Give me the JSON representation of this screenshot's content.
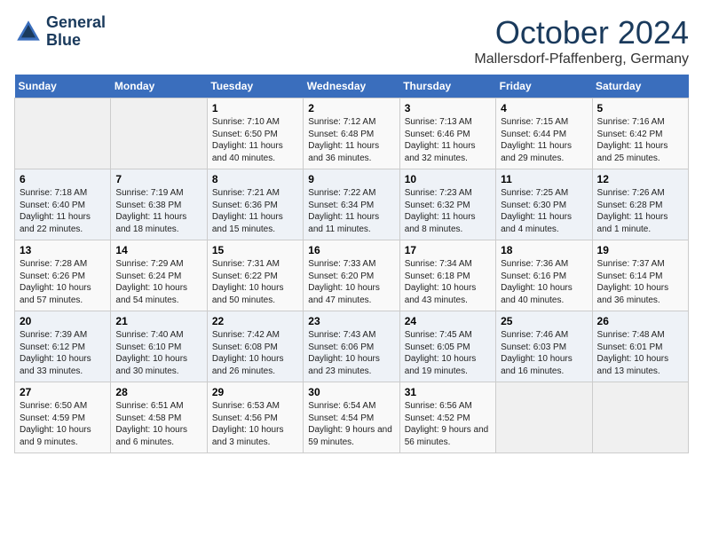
{
  "header": {
    "logo_line1": "General",
    "logo_line2": "Blue",
    "month": "October 2024",
    "location": "Mallersdorf-Pfaffenberg, Germany"
  },
  "weekdays": [
    "Sunday",
    "Monday",
    "Tuesday",
    "Wednesday",
    "Thursday",
    "Friday",
    "Saturday"
  ],
  "weeks": [
    [
      {
        "day": "",
        "info": ""
      },
      {
        "day": "",
        "info": ""
      },
      {
        "day": "1",
        "info": "Sunrise: 7:10 AM\nSunset: 6:50 PM\nDaylight: 11 hours and 40 minutes."
      },
      {
        "day": "2",
        "info": "Sunrise: 7:12 AM\nSunset: 6:48 PM\nDaylight: 11 hours and 36 minutes."
      },
      {
        "day": "3",
        "info": "Sunrise: 7:13 AM\nSunset: 6:46 PM\nDaylight: 11 hours and 32 minutes."
      },
      {
        "day": "4",
        "info": "Sunrise: 7:15 AM\nSunset: 6:44 PM\nDaylight: 11 hours and 29 minutes."
      },
      {
        "day": "5",
        "info": "Sunrise: 7:16 AM\nSunset: 6:42 PM\nDaylight: 11 hours and 25 minutes."
      }
    ],
    [
      {
        "day": "6",
        "info": "Sunrise: 7:18 AM\nSunset: 6:40 PM\nDaylight: 11 hours and 22 minutes."
      },
      {
        "day": "7",
        "info": "Sunrise: 7:19 AM\nSunset: 6:38 PM\nDaylight: 11 hours and 18 minutes."
      },
      {
        "day": "8",
        "info": "Sunrise: 7:21 AM\nSunset: 6:36 PM\nDaylight: 11 hours and 15 minutes."
      },
      {
        "day": "9",
        "info": "Sunrise: 7:22 AM\nSunset: 6:34 PM\nDaylight: 11 hours and 11 minutes."
      },
      {
        "day": "10",
        "info": "Sunrise: 7:23 AM\nSunset: 6:32 PM\nDaylight: 11 hours and 8 minutes."
      },
      {
        "day": "11",
        "info": "Sunrise: 7:25 AM\nSunset: 6:30 PM\nDaylight: 11 hours and 4 minutes."
      },
      {
        "day": "12",
        "info": "Sunrise: 7:26 AM\nSunset: 6:28 PM\nDaylight: 11 hours and 1 minute."
      }
    ],
    [
      {
        "day": "13",
        "info": "Sunrise: 7:28 AM\nSunset: 6:26 PM\nDaylight: 10 hours and 57 minutes."
      },
      {
        "day": "14",
        "info": "Sunrise: 7:29 AM\nSunset: 6:24 PM\nDaylight: 10 hours and 54 minutes."
      },
      {
        "day": "15",
        "info": "Sunrise: 7:31 AM\nSunset: 6:22 PM\nDaylight: 10 hours and 50 minutes."
      },
      {
        "day": "16",
        "info": "Sunrise: 7:33 AM\nSunset: 6:20 PM\nDaylight: 10 hours and 47 minutes."
      },
      {
        "day": "17",
        "info": "Sunrise: 7:34 AM\nSunset: 6:18 PM\nDaylight: 10 hours and 43 minutes."
      },
      {
        "day": "18",
        "info": "Sunrise: 7:36 AM\nSunset: 6:16 PM\nDaylight: 10 hours and 40 minutes."
      },
      {
        "day": "19",
        "info": "Sunrise: 7:37 AM\nSunset: 6:14 PM\nDaylight: 10 hours and 36 minutes."
      }
    ],
    [
      {
        "day": "20",
        "info": "Sunrise: 7:39 AM\nSunset: 6:12 PM\nDaylight: 10 hours and 33 minutes."
      },
      {
        "day": "21",
        "info": "Sunrise: 7:40 AM\nSunset: 6:10 PM\nDaylight: 10 hours and 30 minutes."
      },
      {
        "day": "22",
        "info": "Sunrise: 7:42 AM\nSunset: 6:08 PM\nDaylight: 10 hours and 26 minutes."
      },
      {
        "day": "23",
        "info": "Sunrise: 7:43 AM\nSunset: 6:06 PM\nDaylight: 10 hours and 23 minutes."
      },
      {
        "day": "24",
        "info": "Sunrise: 7:45 AM\nSunset: 6:05 PM\nDaylight: 10 hours and 19 minutes."
      },
      {
        "day": "25",
        "info": "Sunrise: 7:46 AM\nSunset: 6:03 PM\nDaylight: 10 hours and 16 minutes."
      },
      {
        "day": "26",
        "info": "Sunrise: 7:48 AM\nSunset: 6:01 PM\nDaylight: 10 hours and 13 minutes."
      }
    ],
    [
      {
        "day": "27",
        "info": "Sunrise: 6:50 AM\nSunset: 4:59 PM\nDaylight: 10 hours and 9 minutes."
      },
      {
        "day": "28",
        "info": "Sunrise: 6:51 AM\nSunset: 4:58 PM\nDaylight: 10 hours and 6 minutes."
      },
      {
        "day": "29",
        "info": "Sunrise: 6:53 AM\nSunset: 4:56 PM\nDaylight: 10 hours and 3 minutes."
      },
      {
        "day": "30",
        "info": "Sunrise: 6:54 AM\nSunset: 4:54 PM\nDaylight: 9 hours and 59 minutes."
      },
      {
        "day": "31",
        "info": "Sunrise: 6:56 AM\nSunset: 4:52 PM\nDaylight: 9 hours and 56 minutes."
      },
      {
        "day": "",
        "info": ""
      },
      {
        "day": "",
        "info": ""
      }
    ]
  ]
}
